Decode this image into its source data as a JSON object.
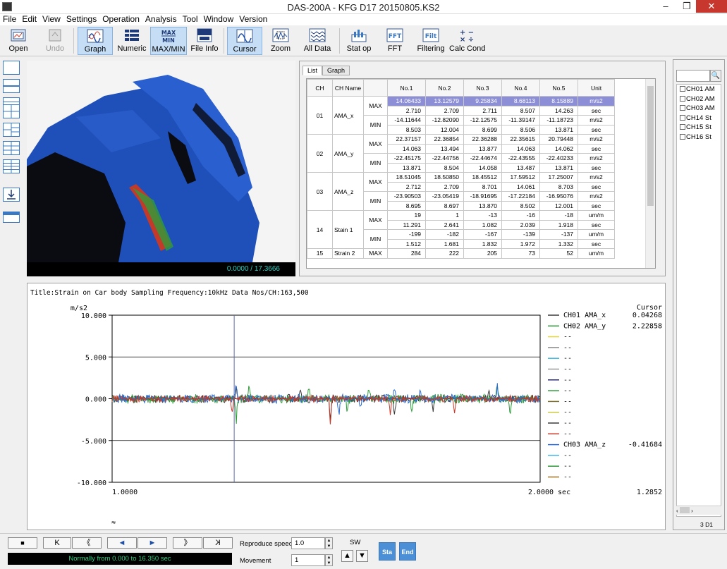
{
  "window": {
    "title": "DAS-200A  -  KFG D17 20150805.KS2",
    "minimize": "–",
    "maximize": "❐",
    "close": "✕"
  },
  "menu": [
    "File",
    "Edit",
    "View",
    "Settings",
    "Operation",
    "Analysis",
    "Tool",
    "Window",
    "Version"
  ],
  "toolbar": [
    {
      "label": "Open",
      "icon": "open-folder-icon"
    },
    {
      "label": "Undo",
      "icon": "undo-icon",
      "disabled": true
    },
    {
      "label": "Graph",
      "icon": "graph-icon",
      "active": true
    },
    {
      "label": "Numeric",
      "icon": "numeric-grid-icon"
    },
    {
      "label": "MAX/MIN",
      "icon": "max-min-icon",
      "active": true
    },
    {
      "label": "File Info",
      "icon": "data-info-icon"
    },
    {
      "label": "Cursor",
      "icon": "cursor-wave-icon",
      "active": true
    },
    {
      "label": "Zoom",
      "icon": "zoom-icon"
    },
    {
      "label": "All Data",
      "icon": "all-data-icon"
    },
    {
      "label": "Stat op",
      "icon": "stats-icon"
    },
    {
      "label": "FFT",
      "icon": "fft-icon"
    },
    {
      "label": "Filtering",
      "icon": "filter-icon"
    },
    {
      "label": "Calc Cond",
      "icon": "calc-icon"
    }
  ],
  "video": {
    "time": "0.0000 / 17.3666"
  },
  "list_panel": {
    "tabs": [
      "List",
      "Graph"
    ],
    "headers": [
      "CH",
      "CH Name",
      "",
      "No.1",
      "No.2",
      "No.3",
      "No.4",
      "No.5",
      "Unit"
    ],
    "channels": [
      {
        "ch": "01",
        "name": "AMA_x",
        "rows": [
          {
            "mm": "MAX",
            "vals": [
              "14.06433",
              "13.12579",
              "9.25834",
              "8.68113",
              "8.15889"
            ],
            "unit": "m/s2",
            "hl": true
          },
          {
            "mm": "",
            "vals": [
              "2.710",
              "2.709",
              "2.711",
              "8.507",
              "14.263"
            ],
            "unit": "sec"
          },
          {
            "mm": "MIN",
            "vals": [
              "-14.11644",
              "-12.82090",
              "-12.12575",
              "-11.39147",
              "-11.18723"
            ],
            "unit": "m/s2"
          },
          {
            "mm": "",
            "vals": [
              "8.503",
              "12.004",
              "8.699",
              "8.506",
              "13.871"
            ],
            "unit": "sec"
          }
        ]
      },
      {
        "ch": "02",
        "name": "AMA_y",
        "rows": [
          {
            "mm": "MAX",
            "vals": [
              "22.37157",
              "22.36854",
              "22.36288",
              "22.35615",
              "20.79448"
            ],
            "unit": "m/s2"
          },
          {
            "mm": "",
            "vals": [
              "14.063",
              "13.494",
              "13.877",
              "14.063",
              "14.062"
            ],
            "unit": "sec"
          },
          {
            "mm": "MIN",
            "vals": [
              "-22.45175",
              "-22.44756",
              "-22.44674",
              "-22.43555",
              "-22.40233"
            ],
            "unit": "m/s2"
          },
          {
            "mm": "",
            "vals": [
              "13.871",
              "8.504",
              "14.058",
              "13.487",
              "13.871"
            ],
            "unit": "sec"
          }
        ]
      },
      {
        "ch": "03",
        "name": "AMA_z",
        "rows": [
          {
            "mm": "MAX",
            "vals": [
              "18.51045",
              "18.50850",
              "18.45512",
              "17.59512",
              "17.25007"
            ],
            "unit": "m/s2"
          },
          {
            "mm": "",
            "vals": [
              "2.712",
              "2.709",
              "8.701",
              "14.061",
              "8.703"
            ],
            "unit": "sec"
          },
          {
            "mm": "MIN",
            "vals": [
              "-23.90503",
              "-23.05419",
              "-18.91695",
              "-17.22184",
              "-16.95076"
            ],
            "unit": "m/s2"
          },
          {
            "mm": "",
            "vals": [
              "8.695",
              "8.697",
              "13.870",
              "8.502",
              "12.001"
            ],
            "unit": "sec"
          }
        ]
      },
      {
        "ch": "14",
        "name": "Stain 1",
        "rows": [
          {
            "mm": "MAX",
            "vals": [
              "19",
              "1",
              "-13",
              "-16",
              "-18"
            ],
            "unit": "um/m"
          },
          {
            "mm": "",
            "vals": [
              "11.291",
              "2.641",
              "1.082",
              "2.039",
              "1.918"
            ],
            "unit": "sec"
          },
          {
            "mm": "MIN",
            "vals": [
              "-199",
              "-182",
              "-167",
              "-139",
              "-137"
            ],
            "unit": "um/m"
          },
          {
            "mm": "",
            "vals": [
              "1.512",
              "1.681",
              "1.832",
              "1.972",
              "1.332"
            ],
            "unit": "sec"
          }
        ]
      },
      {
        "ch": "15",
        "name": "Strain 2",
        "rows": [
          {
            "mm": "MAX",
            "vals": [
              "284",
              "222",
              "205",
              "73",
              "52"
            ],
            "unit": "um/m"
          }
        ]
      }
    ]
  },
  "chart_header": "Title:Strain on Car body  Sampling Frequency:10kHz  Data Nos/CH:163,500",
  "chart_data": {
    "type": "line",
    "ylabel": "m/s2",
    "y_ticks": [
      "10.000",
      "5.000",
      "0.000",
      "-5.000",
      "-10.000"
    ],
    "ylim": [
      -10,
      10
    ],
    "xlim": [
      1.0,
      2.0
    ],
    "x_ticks": [
      "1.0000",
      "2.0000 sec"
    ],
    "cursor_x": 1.2852,
    "cursor_label": "Cursor",
    "cursor_readout": "1.2852",
    "series": [
      {
        "name": "CH01 AMA_x",
        "color": "#3a3a3a",
        "value": "0.04268",
        "amp": 0.9,
        "peaks": [
          [
            1.29,
            2.6
          ],
          [
            1.29,
            -1.2
          ],
          [
            1.44,
            1.1
          ],
          [
            1.51,
            -2.5
          ],
          [
            1.66,
            -2.2
          ],
          [
            1.75,
            -1.5
          ],
          [
            1.88,
            1.4
          ]
        ]
      },
      {
        "name": "CH02 AMA_y",
        "color": "#2e9c3a",
        "value": "2.22858",
        "amp": 1.0,
        "peaks": [
          [
            1.29,
            -2.8
          ],
          [
            1.32,
            1.6
          ],
          [
            1.46,
            1.5
          ],
          [
            1.55,
            -1.8
          ],
          [
            1.6,
            1.5
          ],
          [
            1.7,
            -2.0
          ],
          [
            1.9,
            1.9
          ],
          [
            1.93,
            -1.7
          ]
        ]
      },
      {
        "name": "CH03 AMA_z",
        "color": "#2c6bcf",
        "value": "-0.41684",
        "amp": 0.9,
        "peaks": [
          [
            1.29,
            1.7
          ],
          [
            1.53,
            -2.3
          ],
          [
            1.58,
            4.8
          ],
          [
            1.58,
            -5.9
          ],
          [
            1.66,
            1.5
          ],
          [
            1.72,
            1.2
          ],
          [
            1.9,
            1.7
          ]
        ]
      },
      {
        "name": "",
        "color": "#c43a2a",
        "value": "",
        "amp": 0.7,
        "peaks": [
          [
            1.28,
            -2.0
          ],
          [
            1.51,
            -3.0
          ],
          [
            1.65,
            -2.0
          ],
          [
            1.8,
            -1.8
          ]
        ]
      }
    ],
    "legend_placeholders": [
      {
        "label": "--",
        "color": "#e8d832"
      },
      {
        "label": "--",
        "color": "#8a8a8a"
      },
      {
        "label": "--",
        "color": "#3fb8e8"
      },
      {
        "label": "--",
        "color": "#9a9a9a"
      },
      {
        "label": "--",
        "color": "#2d2d6e"
      },
      {
        "label": "--",
        "color": "#2e9c3a"
      },
      {
        "label": "--",
        "color": "#7a6e2a"
      },
      {
        "label": "--",
        "color": "#c8c840"
      },
      {
        "label": "--",
        "color": "#3a3a3a"
      },
      {
        "label": "--",
        "color": "#c43a2a"
      },
      {
        "label": "--",
        "color": "#3fb8e8"
      },
      {
        "label": "--",
        "color": "#2e9c3a"
      },
      {
        "label": "--",
        "color": "#9a7020"
      }
    ],
    "grid": true
  },
  "side_list": {
    "items": [
      "CH01  AM",
      "CH02  AM",
      "CH03  AM",
      "CH14  St",
      "CH15  St",
      "CH16  St"
    ],
    "footer": "3 D1"
  },
  "bottom": {
    "buttons": [
      "■",
      "K",
      "《",
      "◄",
      "►",
      "》",
      "K"
    ],
    "status": "Normally  from 0.000 to 16.350 sec",
    "reproduce_label": "Reproduce speed",
    "reproduce_value": "1.0",
    "movement_label": "Movement",
    "movement_value": "1",
    "sw_label": "SW",
    "up": "▲",
    "down": "▼",
    "sta": "Sta",
    "end": "End"
  }
}
